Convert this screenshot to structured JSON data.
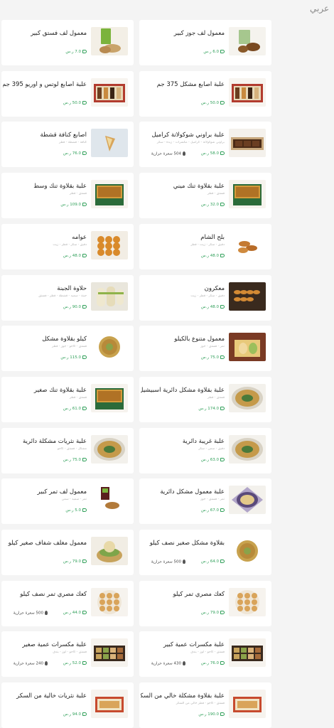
{
  "header": {
    "language_label": "عربي"
  },
  "products": [
    {
      "title": "معمول لف فستق كبير",
      "description": "",
      "price": "7.0 ر.س",
      "calories": "",
      "image_kind": "pistachio"
    },
    {
      "title": "معمول لف جوز كبير",
      "description": "",
      "price": "6.0 ر.س",
      "calories": "",
      "image_kind": "walnut"
    },
    {
      "title": "علبة أصابع لوتس و أوريو 395 جم",
      "description": "",
      "price": "50.0 ر.س",
      "calories": "",
      "image_kind": "box"
    },
    {
      "title": "علبة اصابع مشكل 375 جم",
      "description": "",
      "price": "50.0 ر.س",
      "calories": "",
      "image_kind": "box"
    },
    {
      "title": "اصابع كنافة قشطة",
      "description": "كنافة - قشطة - قطر",
      "price": "76.0 ر.س",
      "calories": "",
      "image_kind": "cone"
    },
    {
      "title": "علبة براوني شوكولاتة كراميل",
      "description": "براوني شوكولاتة - كراميل - مكسرات - زبدة - سكر",
      "price": "58.0 ر.س",
      "calories": "504 سعرة حرارية",
      "image_kind": "brownie"
    },
    {
      "title": "علبة بقلاوة تنك وسط",
      "description": "فستق - قطر",
      "price": "109.0 ر.س",
      "calories": "",
      "image_kind": "tin"
    },
    {
      "title": "علبة بقلاوة تنك ميني",
      "description": "فستق - قطر",
      "price": "32.0 ر.س",
      "calories": "",
      "image_kind": "tin"
    },
    {
      "title": "عوامه",
      "description": "دقيق - سكر - قطر - زيت",
      "price": "48.0 ر.س",
      "calories": "",
      "image_kind": "balls"
    },
    {
      "title": "بلح الشام",
      "description": "دقيق - سكر - زيت - قطر",
      "price": "48.0 ر.س",
      "calories": "",
      "image_kind": "churros"
    },
    {
      "title": "حلاوة الجبنة",
      "description": "جبنة - سميد - قشطة - قطر - فستق",
      "price": "90.0 ر.س",
      "calories": "",
      "image_kind": "rolls"
    },
    {
      "title": "معكرون",
      "description": "دقيق - سكر - قطر - زيت",
      "price": "48.0 ر.س",
      "calories": "",
      "image_kind": "macaroon"
    },
    {
      "title": "كيلو بقلاوة مشكل",
      "description": "فستق - كاجو - جوز - قطر",
      "price": "115.0 ر.س",
      "calories": "",
      "image_kind": "plate"
    },
    {
      "title": "معمول متنوع بالكيلو",
      "description": "تمر - فستق - جوز",
      "price": "75.0 ر.س",
      "calories": "",
      "image_kind": "assorted"
    },
    {
      "title": "علبة بقلاوة تنك صغير",
      "description": "فستق - قطر",
      "price": "61.0 ر.س",
      "calories": "",
      "image_kind": "tin"
    },
    {
      "title": "علبة بقلاوة مشكل دائرية اسبيشيل",
      "description": "فستق - قطر",
      "price": "174.0 ر.س",
      "calories": "",
      "image_kind": "round"
    },
    {
      "title": "علبة نثريات مشكلة دائرية",
      "description": "مشكل - فستق - كاجو",
      "price": "75.0 ر.س",
      "calories": "",
      "image_kind": "round"
    },
    {
      "title": "علبة غريبة دائرية",
      "description": "دقيق - سمن - سكر",
      "price": "63.0 ر.س",
      "calories": "",
      "image_kind": "round"
    },
    {
      "title": "معمول لف تمر كبير",
      "description": "تمر - سميد - سمن",
      "price": "5.0 ر.س",
      "calories": "",
      "image_kind": "date"
    },
    {
      "title": "علبة معمول مشكل دائرية",
      "description": "تمر - فستق - جوز",
      "price": "67.0 ر.س",
      "calories": "",
      "image_kind": "purple"
    },
    {
      "title": "معمول مغلف شفاف صغير كيلو",
      "description": "",
      "price": "79.0 ر.س",
      "calories": "",
      "image_kind": "basket"
    },
    {
      "title": "بقلاوة مشكل صغير نصف كيلو",
      "description": "",
      "price": "64.0 ر.س",
      "calories": "500 سعرة حرارية",
      "image_kind": "plate"
    },
    {
      "title": "كعك مصري تمر نصف كيلو",
      "description": "",
      "price": "44.0 ر.س",
      "calories": "500 سعرة حرارية",
      "image_kind": "cookies"
    },
    {
      "title": "كعك مصري تمر كيلو",
      "description": "",
      "price": "79.0 ر.س",
      "calories": "",
      "image_kind": "cookies"
    },
    {
      "title": "علبة مكسرات عمية صغير",
      "description": "فستق - كاجو - لوز - بندق",
      "price": "52.0 ر.س",
      "calories": "240 سعرة حرارية",
      "image_kind": "nutbox"
    },
    {
      "title": "علبة مكسرات عمية كبير",
      "description": "فستق - كاجو - لوز - بندق",
      "price": "76.0 ر.س",
      "calories": "430 سعرة حرارية",
      "image_kind": "nutbox"
    },
    {
      "title": "علبة نثريات خالية من السكر",
      "description": "",
      "price": "94.0 ر.س",
      "calories": "",
      "image_kind": "sugarfree"
    },
    {
      "title": "علبة بقلاوة مشكلة خالي من السكر",
      "description": "فستق - كاجو - قطر خالي من السكر",
      "price": "190.0 ر.س",
      "calories": "",
      "image_kind": "sugarfree"
    }
  ],
  "colors": {
    "price": "#2e9f58",
    "card_bg": "#ffffff",
    "page_bg": "#f4f4f4"
  }
}
